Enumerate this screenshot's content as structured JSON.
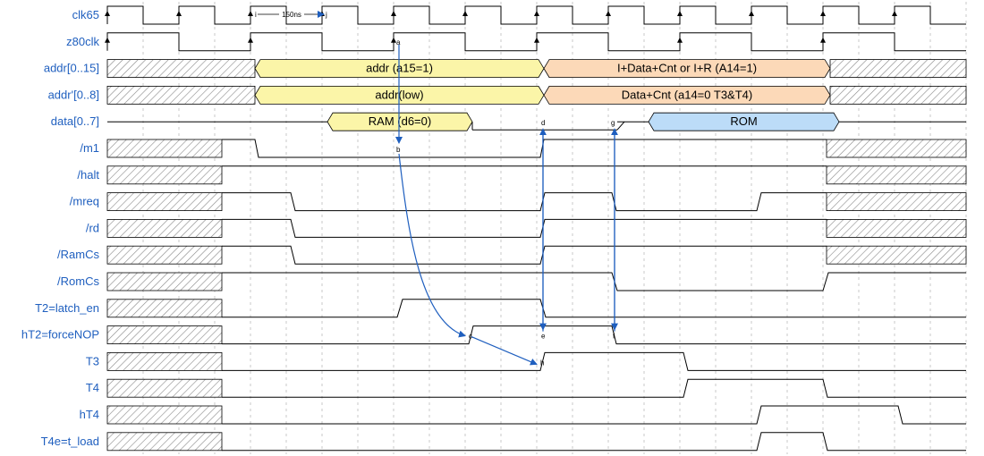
{
  "colors": {
    "label": "#1f5fbf",
    "arrow": "#1f5fbf",
    "bus_yellow": "#fbf5a8",
    "bus_orange": "#fcd9b8",
    "bus_blue": "#bcdcf8",
    "hatch": "#888888"
  },
  "signals": [
    {
      "name": "clk65"
    },
    {
      "name": "z80clk"
    },
    {
      "name": "addr[0..15]"
    },
    {
      "name": "addr'[0..8]"
    },
    {
      "name": "data[0..7]"
    },
    {
      "name": "/m1"
    },
    {
      "name": "/halt"
    },
    {
      "name": "/mreq"
    },
    {
      "name": "/rd"
    },
    {
      "name": "/RamCs"
    },
    {
      "name": "/RomCs"
    },
    {
      "name": "T2=latch_en"
    },
    {
      "name": "hT2=forceNOP"
    },
    {
      "name": "T3"
    },
    {
      "name": "T4"
    },
    {
      "name": "hT4"
    },
    {
      "name": "T4e=t_load"
    }
  ],
  "bus_segments": {
    "addr": [
      {
        "text": "addr (a15=1)",
        "color": "yellow"
      },
      {
        "text": "I+Data+Cnt or I+R (A14=1)",
        "color": "orange"
      }
    ],
    "addr_low": [
      {
        "text": "addr(low)",
        "color": "yellow"
      },
      {
        "text": "Data+Cnt (a14=0 T3&T4)",
        "color": "orange"
      }
    ],
    "data": [
      {
        "text": "RAM (d6=0)",
        "color": "yellow"
      },
      {
        "text": "ROM",
        "color": "blue"
      }
    ]
  },
  "annotations": {
    "period": "150ns",
    "period_left": "i",
    "period_right": "j",
    "markers": [
      "a",
      "b",
      "c",
      "d",
      "e",
      "f",
      "g",
      "h"
    ]
  }
}
